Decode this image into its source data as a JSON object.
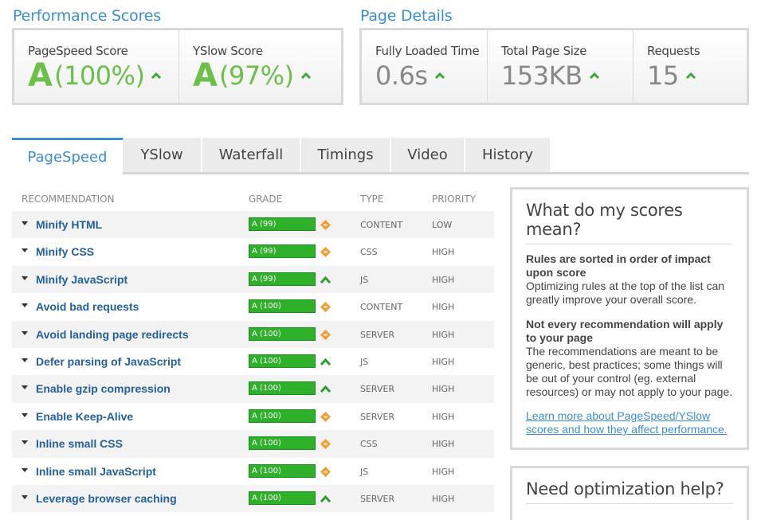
{
  "performance_scores": {
    "title": "Performance Scores",
    "pagespeed": {
      "label": "PageSpeed Score",
      "grade": "A",
      "pct": "(100%)"
    },
    "yslow": {
      "label": "YSlow Score",
      "grade": "A",
      "pct": "(97%)"
    }
  },
  "page_details": {
    "title": "Page Details",
    "loaded": {
      "label": "Fully Loaded Time",
      "value": "0.6s"
    },
    "size": {
      "label": "Total Page Size",
      "value": "153KB"
    },
    "requests": {
      "label": "Requests",
      "value": "15"
    }
  },
  "tabs": [
    {
      "label": "PageSpeed",
      "active": true
    },
    {
      "label": "YSlow"
    },
    {
      "label": "Waterfall"
    },
    {
      "label": "Timings"
    },
    {
      "label": "Video"
    },
    {
      "label": "History"
    }
  ],
  "table": {
    "headers": {
      "recommendation": "RECOMMENDATION",
      "grade": "GRADE",
      "type": "TYPE",
      "priority": "PRIORITY"
    },
    "rows": [
      {
        "name": "Minify HTML",
        "grade": "A (99)",
        "indicator": "diamond",
        "type": "CONTENT",
        "priority": "LOW"
      },
      {
        "name": "Minify CSS",
        "grade": "A (99)",
        "indicator": "diamond",
        "type": "CSS",
        "priority": "HIGH"
      },
      {
        "name": "Minify JavaScript",
        "grade": "A (99)",
        "indicator": "up",
        "type": "JS",
        "priority": "HIGH"
      },
      {
        "name": "Avoid bad requests",
        "grade": "A (100)",
        "indicator": "diamond",
        "type": "CONTENT",
        "priority": "HIGH"
      },
      {
        "name": "Avoid landing page redirects",
        "grade": "A (100)",
        "indicator": "diamond",
        "type": "SERVER",
        "priority": "HIGH"
      },
      {
        "name": "Defer parsing of JavaScript",
        "grade": "A (100)",
        "indicator": "up",
        "type": "JS",
        "priority": "HIGH"
      },
      {
        "name": "Enable gzip compression",
        "grade": "A (100)",
        "indicator": "up",
        "type": "SERVER",
        "priority": "HIGH"
      },
      {
        "name": "Enable Keep-Alive",
        "grade": "A (100)",
        "indicator": "diamond",
        "type": "SERVER",
        "priority": "HIGH"
      },
      {
        "name": "Inline small CSS",
        "grade": "A (100)",
        "indicator": "diamond",
        "type": "CSS",
        "priority": "HIGH"
      },
      {
        "name": "Inline small JavaScript",
        "grade": "A (100)",
        "indicator": "diamond",
        "type": "JS",
        "priority": "HIGH"
      },
      {
        "name": "Leverage browser caching",
        "grade": "A (100)",
        "indicator": "up",
        "type": "SERVER",
        "priority": "HIGH"
      }
    ]
  },
  "scores_panel": {
    "title": "What do my scores mean?",
    "p1_bold": "Rules are sorted in order of impact upon score",
    "p1_text": "Optimizing rules at the top of the list can greatly improve your overall score.",
    "p2_bold": "Not every recommendation will apply to your page",
    "p2_text": "The recommendations are meant to be generic, best practices; some things will be out of your control (eg. external resources) or may not apply to your page.",
    "link": "Learn more about PageSpeed/YSlow scores and how they affect performance."
  },
  "help_panel": {
    "title": "Need optimization help?"
  },
  "colors": {
    "accent": "#3b8fd1",
    "grade_green": "#6cc04a",
    "bar_green": "#2fb02b",
    "diamond_orange": "#f0a030",
    "link_blue": "#24609c"
  }
}
